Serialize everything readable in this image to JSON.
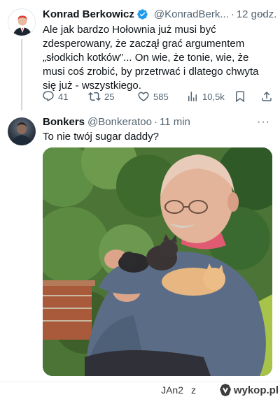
{
  "tweet1": {
    "author_name": "Konrad Berkowicz",
    "handle": "@KonradBerk...",
    "separator": "·",
    "time": "12 godz.",
    "more": "···",
    "text": "Ale jak bardzo Hołownia już musi być zdesperowany, że zaczął grać argumentem „słodkich kotków”... On wie, że tonie, wie, że musi coś zrobić, by przetrwać i dlatego chwyta się już - wszystkiego.",
    "stats": {
      "replies": "41",
      "retweets": "25",
      "likes": "585",
      "views": "10,5k"
    }
  },
  "tweet2": {
    "author_name": "Bonkers",
    "handle": "@Bonkeratoo",
    "separator": "·",
    "time": "11 min",
    "more": "···",
    "text": "To nie twój sugar daddy?"
  },
  "footer": {
    "username": "JAn2",
    "connector": "z",
    "brand": "wykop.pl"
  },
  "colors": {
    "verified": "#1d9bf0",
    "secondary_text": "#536471",
    "thread_line": "#cfd9de"
  }
}
